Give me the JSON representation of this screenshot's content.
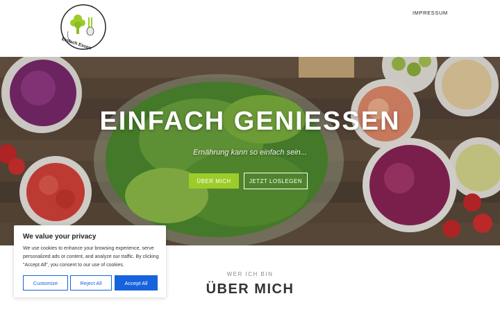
{
  "header": {
    "logo_text": "Einfach Essen",
    "nav": [
      {
        "label": "IMPRESSUM"
      }
    ]
  },
  "hero": {
    "title": "EINFACH GENIESSEN",
    "subtitle": "Ernährung kann so einfach sein...",
    "primary_button": "ÜBER MICH",
    "secondary_button": "JETZT LOSLEGEN"
  },
  "about": {
    "eyebrow": "WER ICH BIN",
    "title": "ÜBER MICH"
  },
  "cookie_banner": {
    "title": "We value your privacy",
    "text": "We use cookies to enhance your browsing experience, serve personalized ads or content, and analyze our traffic. By clicking \"Accept All\", you consent to our use of cookies.",
    "customize": "Customize",
    "reject": "Reject All",
    "accept": "Accept All"
  },
  "colors": {
    "accent_green": "#9ccc2a",
    "cookie_blue": "#1863dc",
    "text_dark": "#333333"
  }
}
